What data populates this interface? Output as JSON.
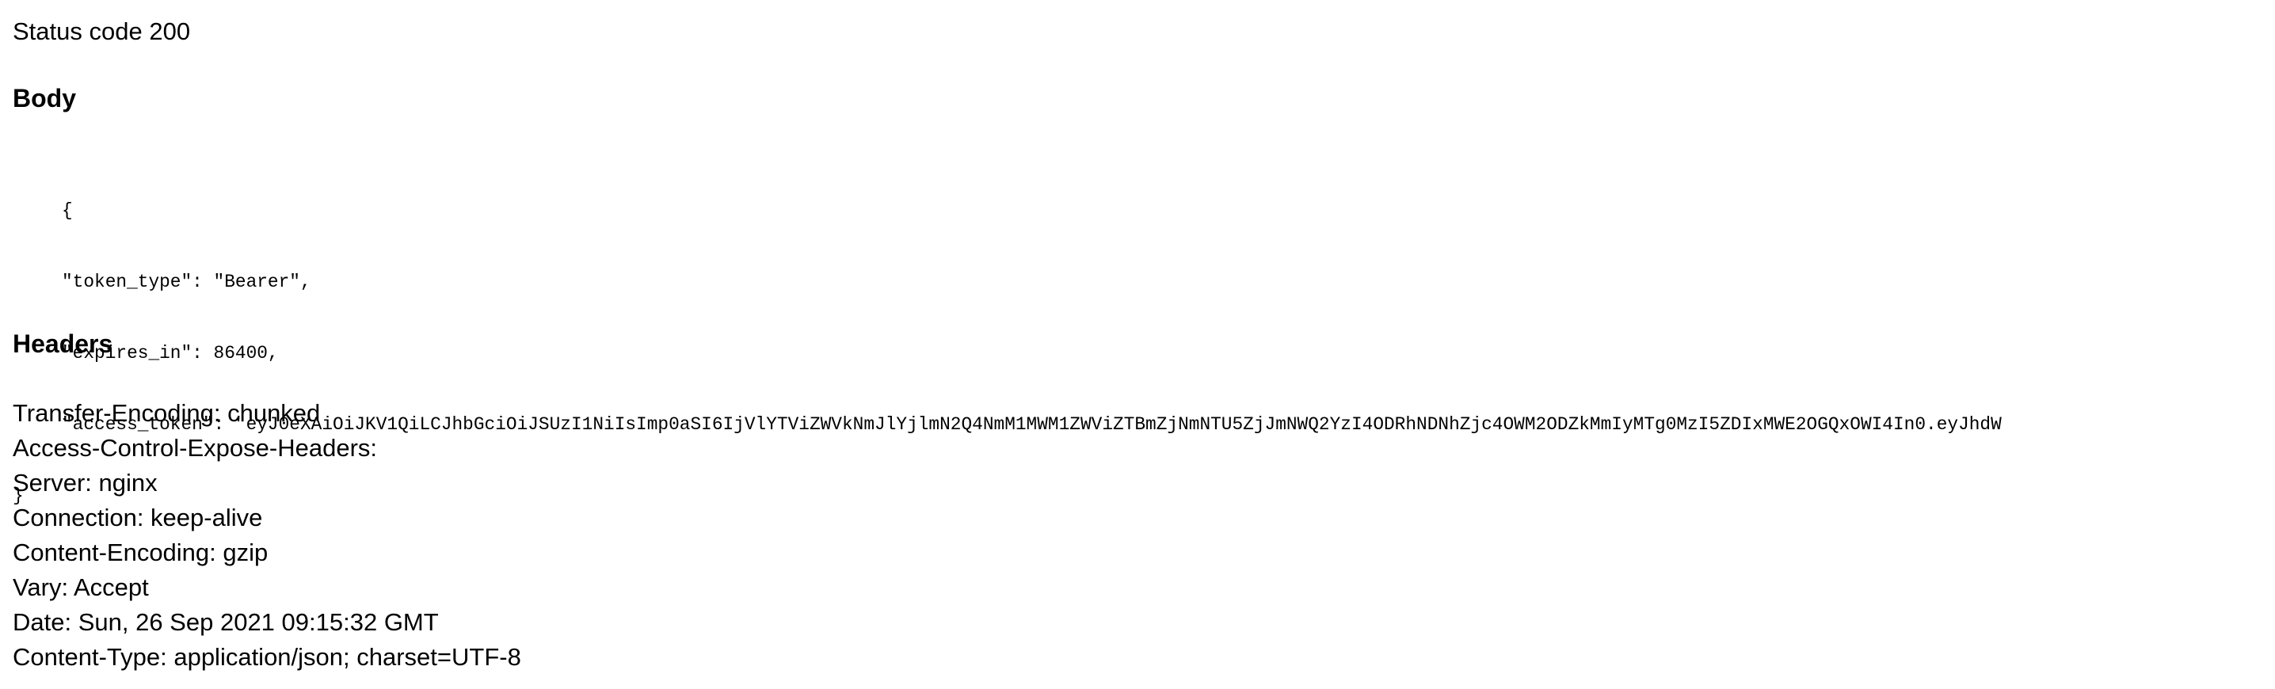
{
  "status": {
    "text": "Status code 200"
  },
  "body_section": {
    "heading": "Body",
    "lines": [
      "{",
      "\"token_type\": \"Bearer\",",
      "\"expires_in\": 86400,",
      "\"access_token\": \"eyJ0eXAiOiJKV1QiLCJhbGciOiJSUzI1NiIsImp0aSI6IjVlYTViZWVkNmJlYjlmN2Q4NmM1MWM1ZWViZTBmZjNmNTU5ZjJmNWQ2YzI4ODRhNDNhZjc4OWM2ODZkMmIyMTg0MzI5ZDIxMWE2OGQxOWI4In0.eyJhdW",
      "}"
    ]
  },
  "headers_section": {
    "heading": "Headers",
    "items": [
      "Transfer-Encoding: chunked",
      "Access-Control-Expose-Headers:",
      "Server: nginx",
      "Connection: keep-alive",
      "Content-Encoding: gzip",
      "Vary: Accept",
      "Date: Sun, 26 Sep 2021 09:15:32 GMT",
      "Content-Type: application/json; charset=UTF-8"
    ]
  }
}
